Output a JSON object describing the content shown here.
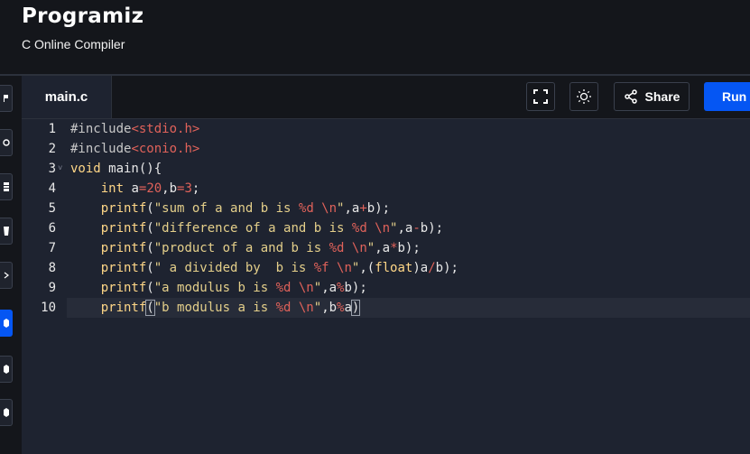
{
  "brand": {
    "logo_text": "Programiz",
    "subtitle": "C Online Compiler"
  },
  "tabs": [
    {
      "label": "main.c",
      "active": true
    }
  ],
  "toolbar": {
    "fullscreen_icon": "fullscreen-icon",
    "theme_icon": "sun-icon",
    "share_label": "Share",
    "share_icon": "share-icon",
    "run_label": "Run"
  },
  "sidebar": {
    "items": [
      {
        "name": "sidebar-lang-python"
      },
      {
        "name": "sidebar-lang-r"
      },
      {
        "name": "sidebar-lang-sql"
      },
      {
        "name": "sidebar-lang-html"
      },
      {
        "name": "sidebar-lang-java"
      },
      {
        "name": "sidebar-lang-c",
        "active": true
      },
      {
        "name": "sidebar-lang-cpp"
      },
      {
        "name": "sidebar-lang-csharp"
      }
    ]
  },
  "editor": {
    "current_line": 10,
    "lines": [
      {
        "num": "1",
        "tokens": [
          {
            "t": "#include",
            "c": "inc"
          },
          {
            "t": "<stdio.h>",
            "c": "hdr"
          }
        ]
      },
      {
        "num": "2",
        "tokens": [
          {
            "t": "#include",
            "c": "inc"
          },
          {
            "t": "<conio.h>",
            "c": "hdr"
          }
        ]
      },
      {
        "num": "3",
        "fold": true,
        "tokens": [
          {
            "t": "void",
            "c": "kw"
          },
          {
            "t": " main(){",
            "c": "id"
          }
        ]
      },
      {
        "num": "4",
        "tokens": [
          {
            "t": "    ",
            "c": "id"
          },
          {
            "t": "int",
            "c": "kw"
          },
          {
            "t": " a",
            "c": "id"
          },
          {
            "t": "=",
            "c": "op"
          },
          {
            "t": "20",
            "c": "num"
          },
          {
            "t": ",b",
            "c": "id"
          },
          {
            "t": "=",
            "c": "op"
          },
          {
            "t": "3",
            "c": "num"
          },
          {
            "t": ";",
            "c": "id"
          }
        ]
      },
      {
        "num": "5",
        "tokens": [
          {
            "t": "    ",
            "c": "id"
          },
          {
            "t": "printf",
            "c": "kw"
          },
          {
            "t": "(",
            "c": "id"
          },
          {
            "t": "\"sum of a and b is ",
            "c": "str"
          },
          {
            "t": "%d \\n",
            "c": "fmt"
          },
          {
            "t": "\"",
            "c": "str"
          },
          {
            "t": ",a",
            "c": "id"
          },
          {
            "t": "+",
            "c": "op"
          },
          {
            "t": "b);",
            "c": "id"
          }
        ]
      },
      {
        "num": "6",
        "tokens": [
          {
            "t": "    ",
            "c": "id"
          },
          {
            "t": "printf",
            "c": "kw"
          },
          {
            "t": "(",
            "c": "id"
          },
          {
            "t": "\"difference of a and b is ",
            "c": "str"
          },
          {
            "t": "%d \\n",
            "c": "fmt"
          },
          {
            "t": "\"",
            "c": "str"
          },
          {
            "t": ",a",
            "c": "id"
          },
          {
            "t": "-",
            "c": "op"
          },
          {
            "t": "b);",
            "c": "id"
          }
        ]
      },
      {
        "num": "7",
        "tokens": [
          {
            "t": "    ",
            "c": "id"
          },
          {
            "t": "printf",
            "c": "kw"
          },
          {
            "t": "(",
            "c": "id"
          },
          {
            "t": "\"product of a and b is ",
            "c": "str"
          },
          {
            "t": "%d \\n",
            "c": "fmt"
          },
          {
            "t": "\"",
            "c": "str"
          },
          {
            "t": ",a",
            "c": "id"
          },
          {
            "t": "*",
            "c": "op"
          },
          {
            "t": "b);",
            "c": "id"
          }
        ]
      },
      {
        "num": "8",
        "tokens": [
          {
            "t": "    ",
            "c": "id"
          },
          {
            "t": "printf",
            "c": "kw"
          },
          {
            "t": "(",
            "c": "id"
          },
          {
            "t": "\" a divided by  b is ",
            "c": "str"
          },
          {
            "t": "%f \\n",
            "c": "fmt"
          },
          {
            "t": "\"",
            "c": "str"
          },
          {
            "t": ",(",
            "c": "id"
          },
          {
            "t": "float",
            "c": "kw"
          },
          {
            "t": ")a",
            "c": "id"
          },
          {
            "t": "/",
            "c": "op"
          },
          {
            "t": "b);",
            "c": "id"
          }
        ]
      },
      {
        "num": "9",
        "tokens": [
          {
            "t": "    ",
            "c": "id"
          },
          {
            "t": "printf",
            "c": "kw"
          },
          {
            "t": "(",
            "c": "id"
          },
          {
            "t": "\"a modulus b is ",
            "c": "str"
          },
          {
            "t": "%d \\n",
            "c": "fmt"
          },
          {
            "t": "\"",
            "c": "str"
          },
          {
            "t": ",a",
            "c": "id"
          },
          {
            "t": "%",
            "c": "op"
          },
          {
            "t": "b);",
            "c": "id"
          }
        ]
      },
      {
        "num": "10",
        "tokens": [
          {
            "t": "    ",
            "c": "id"
          },
          {
            "t": "printf",
            "c": "kw"
          },
          {
            "t": "(",
            "c": "id",
            "b": true
          },
          {
            "t": "\"b modulus a is ",
            "c": "str"
          },
          {
            "t": "%d \\n",
            "c": "fmt"
          },
          {
            "t": "\"",
            "c": "str"
          },
          {
            "t": ",b",
            "c": "id"
          },
          {
            "t": "%",
            "c": "op"
          },
          {
            "t": "a",
            "c": "id"
          },
          {
            "t": ")",
            "c": "id",
            "b": true
          }
        ]
      }
    ]
  }
}
